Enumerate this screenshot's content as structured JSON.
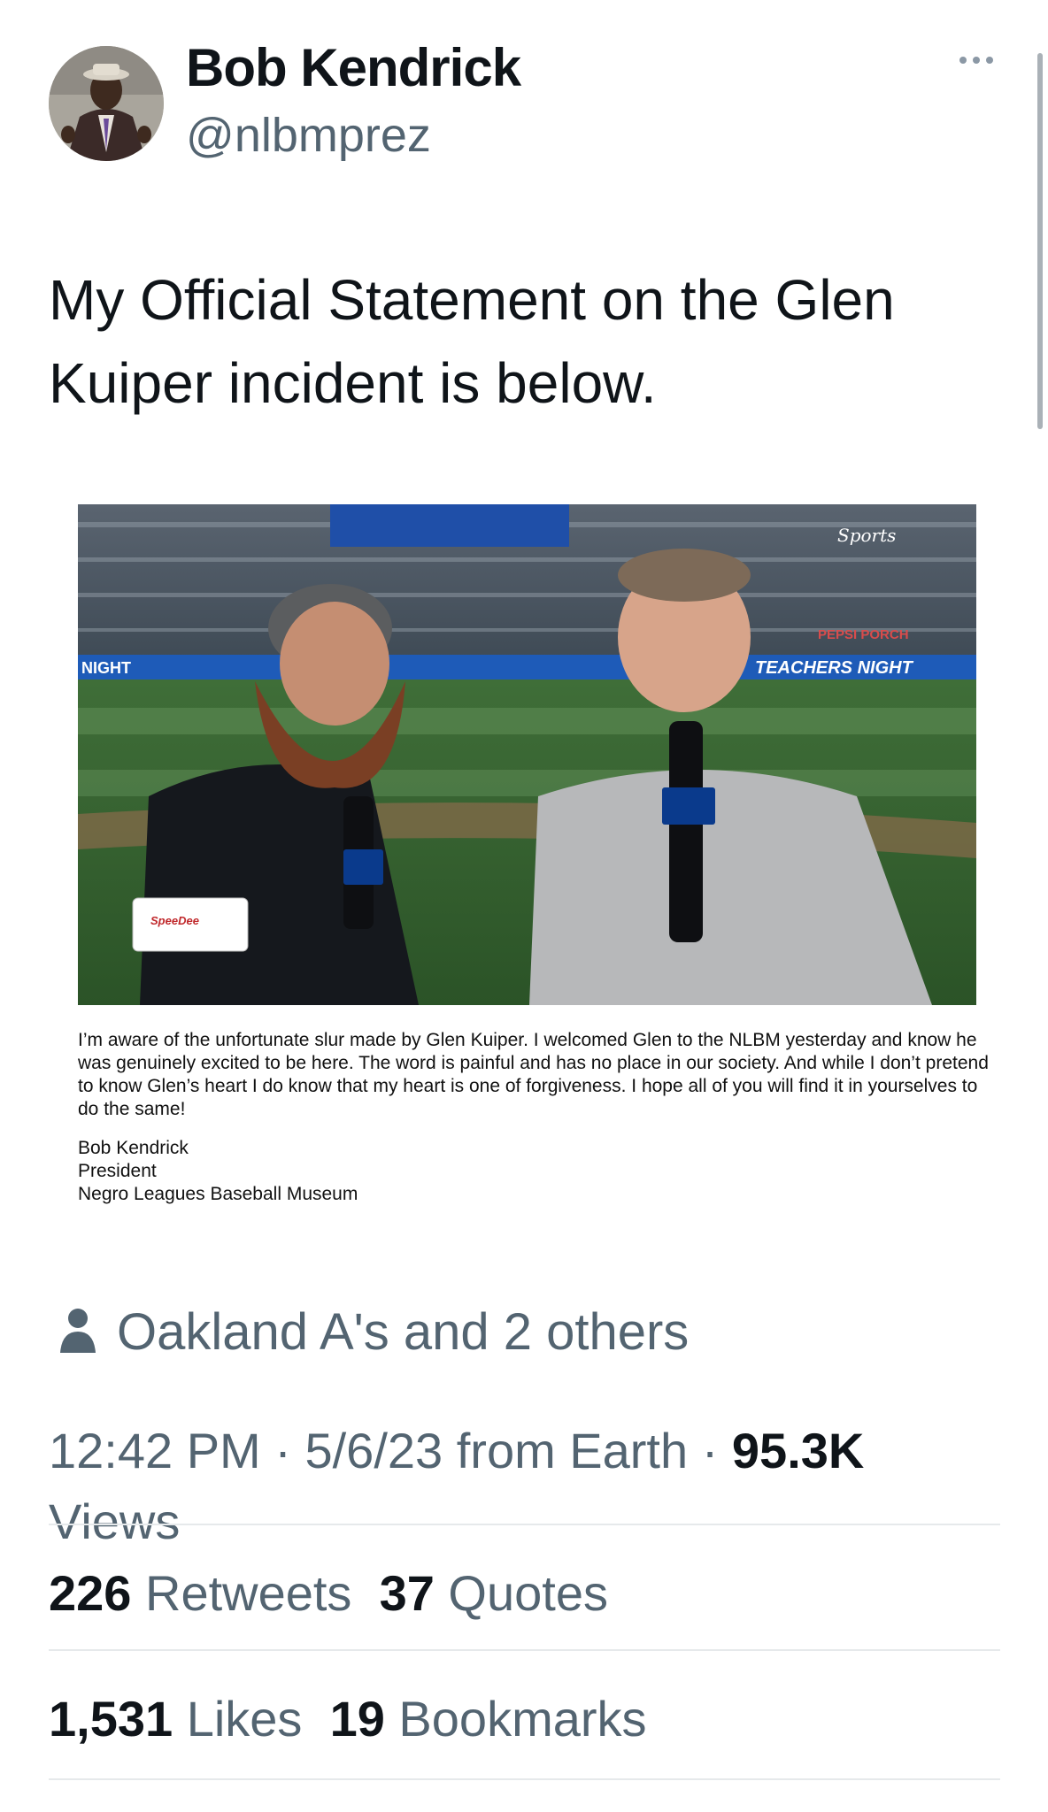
{
  "author": {
    "display_name": "Bob Kendrick",
    "handle": "@nlbmprez"
  },
  "tweet": {
    "text": "My Official Statement on the Glen Kuiper incident is below."
  },
  "media": {
    "broadcast_logo_text": "Sports",
    "sponsor_text": "SpeeDee",
    "banner_left": "NIGHT",
    "banner_right": "TEACHERS NIGHT",
    "sign_text": "PEPSI PORCH"
  },
  "statement": {
    "body": "I’m aware of the unfortunate slur made by Glen Kuiper. I welcomed Glen to the NLBM yesterday and know he was genuinely excited to be here. The word is painful and has no place in our society. And while I don’t pretend to know Glen’s heart I do know that my heart is one of forgiveness. I hope all of you will find it in yourselves to do the same!",
    "signature_name": "Bob Kendrick",
    "signature_title": "President",
    "signature_org": "Negro Leagues Baseball Museum"
  },
  "tagged": {
    "text": "Oakland A's and 2 others",
    "icon": "person-icon"
  },
  "meta": {
    "time": "12:42 PM",
    "sep1": " · ",
    "date": "5/6/23",
    "source": " from Earth",
    "sep2": " · ",
    "views_count": "95.3K",
    "views_label": "Views"
  },
  "stats": {
    "retweets_count": "226",
    "retweets_label": "Retweets",
    "quotes_count": "37",
    "quotes_label": "Quotes",
    "likes_count": "1,531",
    "likes_label": "Likes",
    "bookmarks_count": "19",
    "bookmarks_label": "Bookmarks"
  },
  "colors": {
    "primary_text": "#0f1419",
    "secondary_text": "#536471",
    "divider": "#e6e9eb"
  }
}
